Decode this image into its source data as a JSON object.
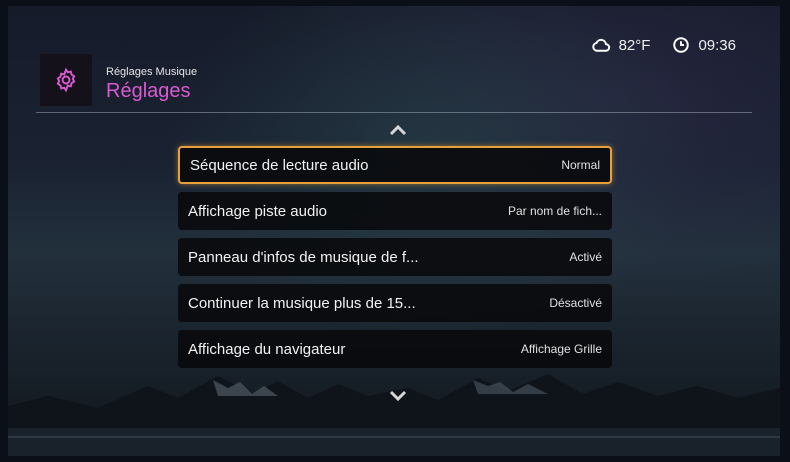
{
  "status": {
    "weather_icon": "cloud-icon",
    "temperature": "82°F",
    "clock_icon": "clock-icon",
    "time": "09:36"
  },
  "header": {
    "icon": "gear-icon",
    "breadcrumb": "Réglages Musique",
    "title": "Réglages",
    "accent_color": "#d85ad0"
  },
  "menu": {
    "selected_color": "#e8a13a",
    "items": [
      {
        "label": "Séquence de lecture audio",
        "value": "Normal"
      },
      {
        "label": "Affichage piste audio",
        "value": "Par nom de fich..."
      },
      {
        "label": "Panneau d'infos de musique de f...",
        "value": "Activé"
      },
      {
        "label": "Continuer la musique plus de 15...",
        "value": "Désactivé"
      },
      {
        "label": "Affichage du navigateur",
        "value": "Affichage Grille"
      }
    ]
  }
}
